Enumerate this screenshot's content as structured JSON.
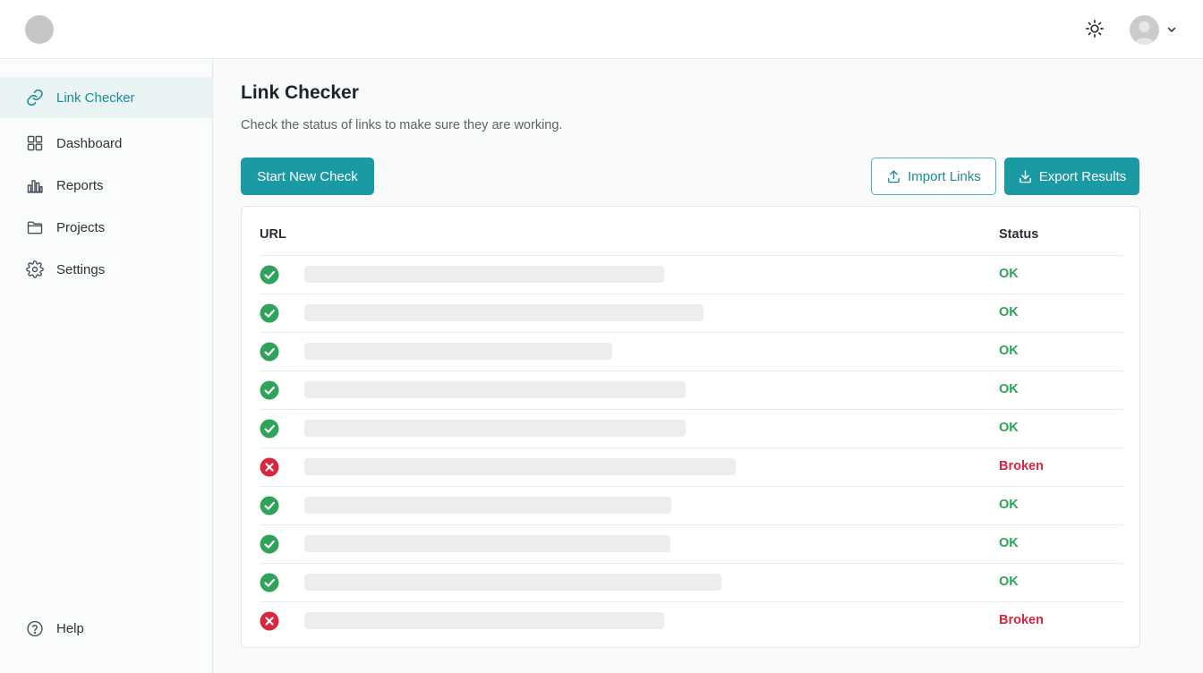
{
  "header": {
    "theme_icon": "sun-icon",
    "user_menu_icon": "chevron-down-icon"
  },
  "sidebar": {
    "items": [
      {
        "label": "Link Checker",
        "icon": "link-icon",
        "active": true
      },
      {
        "label": "Dashboard",
        "icon": "grid-icon",
        "active": false
      },
      {
        "label": "Reports",
        "icon": "bar-chart-icon",
        "active": false
      },
      {
        "label": "Projects",
        "icon": "folder-icon",
        "active": false
      },
      {
        "label": "Settings",
        "icon": "gear-icon",
        "active": false
      }
    ],
    "help": {
      "label": "Help",
      "icon": "help-circle-icon"
    }
  },
  "main": {
    "title": "Link Checker",
    "subtitle": "Check the status of links to make sure they are working.",
    "buttons": {
      "start": "Start New Check",
      "import": "Import Links",
      "export": "Export Results"
    },
    "table": {
      "columns": [
        "URL",
        "Status"
      ],
      "rows": [
        {
          "status": "OK"
        },
        {
          "status": "OK"
        },
        {
          "status": "OK"
        },
        {
          "status": "OK"
        },
        {
          "status": "OK"
        },
        {
          "status": "Broken"
        },
        {
          "status": "OK"
        },
        {
          "status": "OK"
        },
        {
          "status": "OK"
        },
        {
          "status": "Broken"
        }
      ]
    }
  },
  "colors": {
    "accent": "#1b9aa4",
    "ok": "#2fa35a",
    "broken": "#d7263d"
  }
}
